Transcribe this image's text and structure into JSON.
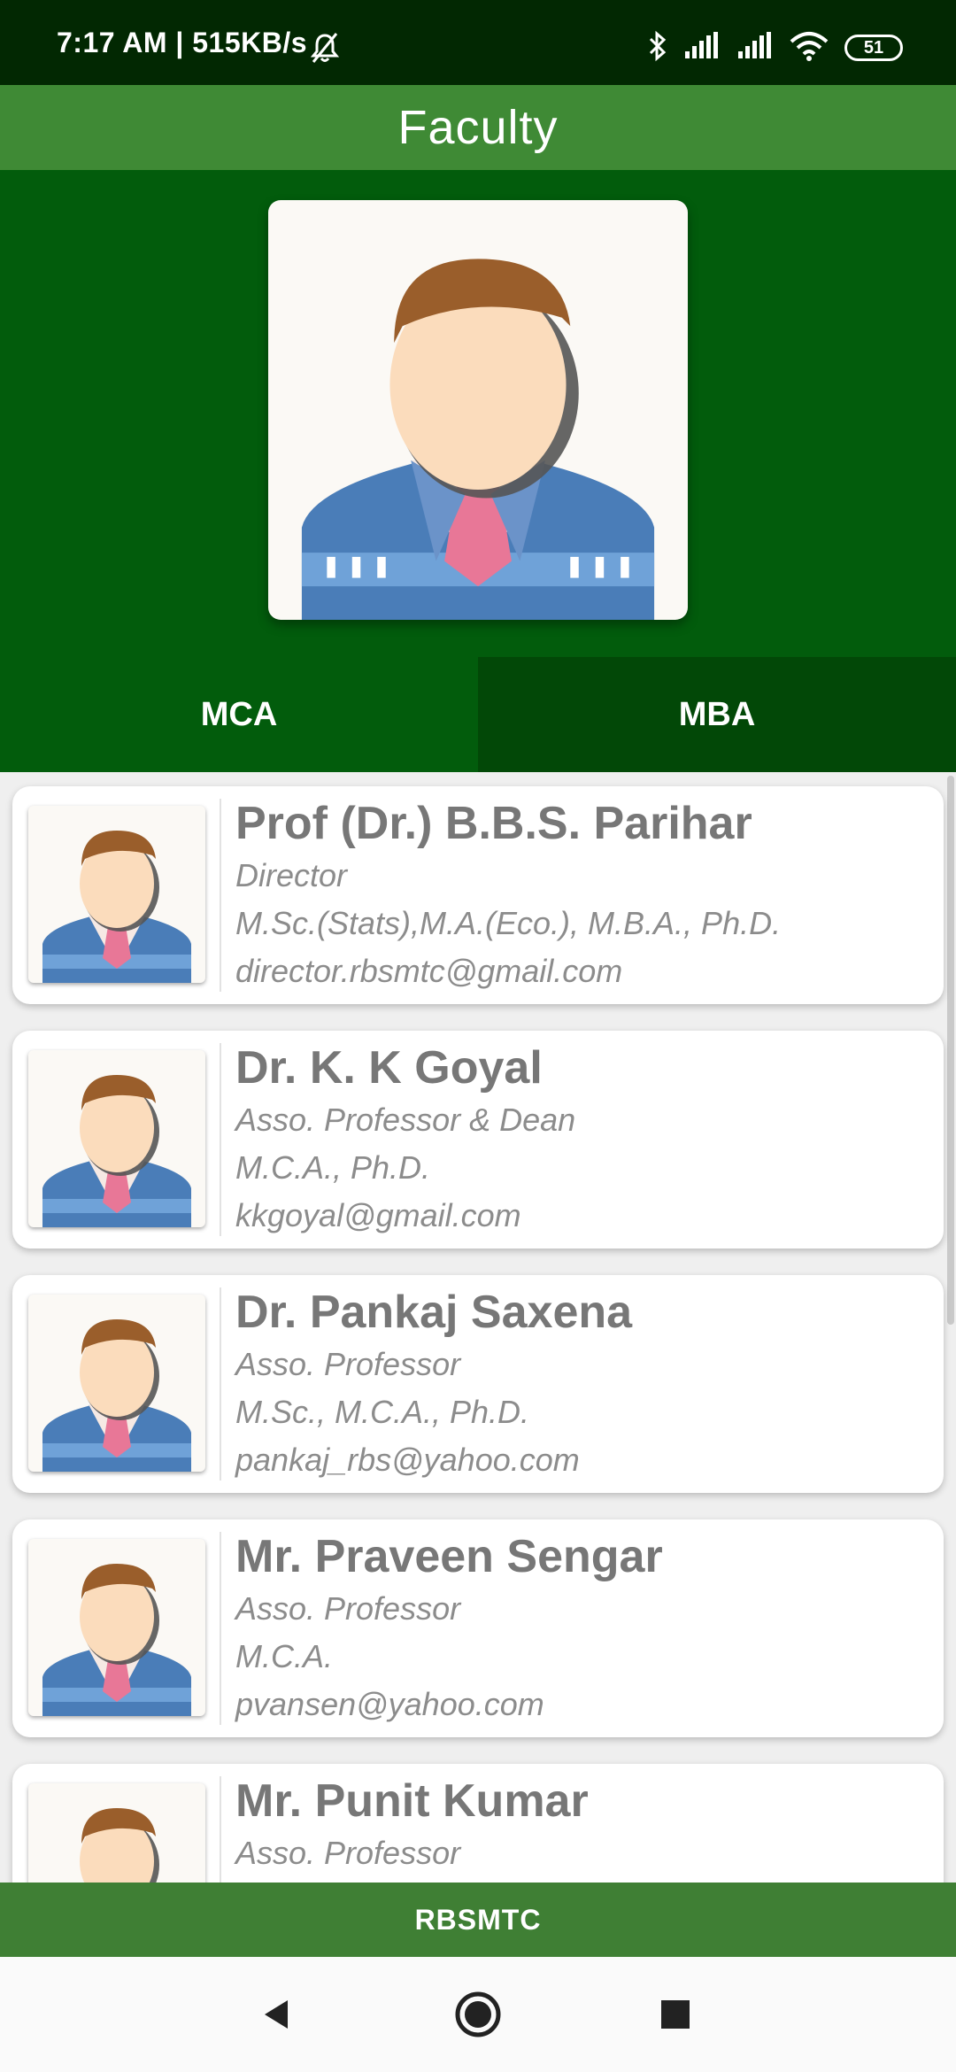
{
  "status_bar": {
    "time_speed": "7:17 AM | 515KB/s",
    "battery_level": "51",
    "icons": [
      "mute-bell-icon",
      "bluetooth-icon",
      "signal-icon",
      "signal-icon",
      "wifi-icon",
      "battery-icon"
    ]
  },
  "app_bar": {
    "title": "Faculty"
  },
  "hero": {
    "avatar_icon": "faculty-avatar-icon"
  },
  "tabs": [
    {
      "label": "MCA",
      "selected": false
    },
    {
      "label": "MBA",
      "selected": true
    }
  ],
  "faculty": [
    {
      "name": "Prof (Dr.) B.B.S. Parihar",
      "designation": "Director",
      "qualification": "M.Sc.(Stats),M.A.(Eco.), M.B.A., Ph.D.",
      "email": "director.rbsmtc@gmail.com"
    },
    {
      "name": "Dr. K. K Goyal",
      "designation": "Asso. Professor & Dean",
      "qualification": "M.C.A., Ph.D.",
      "email": "kkgoyal@gmail.com"
    },
    {
      "name": "Dr. Pankaj Saxena",
      "designation": "Asso. Professor",
      "qualification": "M.Sc., M.C.A., Ph.D.",
      "email": " pankaj_rbs@yahoo.com"
    },
    {
      "name": "Mr. Praveen Sengar",
      "designation": "Asso. Professor",
      "qualification": "M.C.A.",
      "email": "pvansen@yahoo.com"
    },
    {
      "name": "Mr. Punit Kumar",
      "designation": "Asso. Professor",
      "qualification": "",
      "email": ""
    }
  ],
  "bottom_bar": {
    "label": "RBSMTC"
  },
  "nav": {
    "icons": [
      "back-icon",
      "home-icon",
      "recents-icon"
    ]
  },
  "colors": {
    "status_bar": "#022802",
    "app_bar": "#3f8a35",
    "hero": "#025c0c",
    "tab_selected": "#024807",
    "bottom_bar": "#3f7f34"
  }
}
